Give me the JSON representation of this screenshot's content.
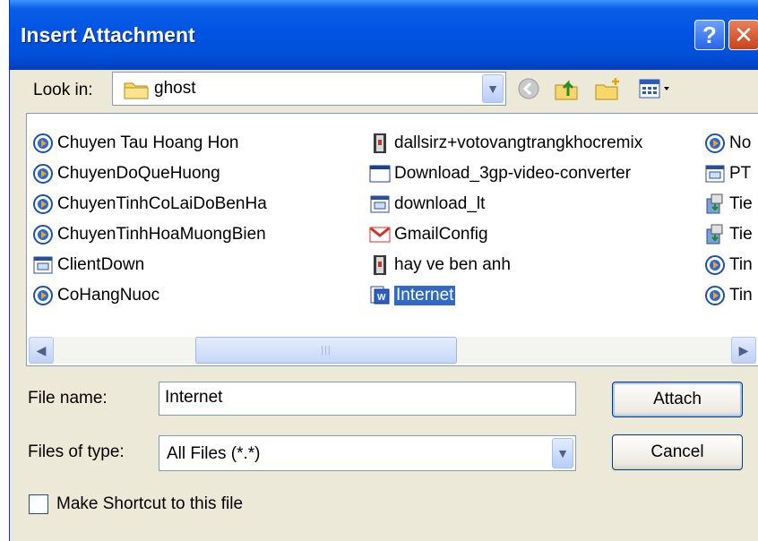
{
  "window": {
    "title": "Insert Attachment",
    "help_glyph": "?",
    "close_glyph": "✕"
  },
  "look_in": {
    "label": "Look in:",
    "value": "ghost"
  },
  "toolbar": {
    "icons": [
      "back-icon",
      "up-folder-icon",
      "new-folder-icon",
      "view-menu-icon"
    ]
  },
  "files": {
    "column1": [
      {
        "name": "Chuyen Tau Hoang Hon",
        "icon": "media-icon"
      },
      {
        "name": "ChuyenDoQueHuong",
        "icon": "media-icon"
      },
      {
        "name": "ChuyenTinhCoLaiDoBenHa",
        "icon": "media-icon"
      },
      {
        "name": "ChuyenTinhHoaMuongBien",
        "icon": "media-icon"
      },
      {
        "name": "ClientDown",
        "icon": "window-icon"
      },
      {
        "name": "CoHangNuoc",
        "icon": "media-icon"
      }
    ],
    "column2": [
      {
        "name": "dallsirz+votovangtrangkhocremix",
        "icon": "archive-icon"
      },
      {
        "name": "Download_3gp-video-converter",
        "icon": "app-window-icon"
      },
      {
        "name": "download_lt",
        "icon": "window-icon"
      },
      {
        "name": "GmailConfig",
        "icon": "gmail-icon"
      },
      {
        "name": "hay ve ben anh",
        "icon": "archive-icon"
      },
      {
        "name": "Internet",
        "icon": "word-doc-icon",
        "selected": true
      }
    ],
    "column3": [
      {
        "name": "No",
        "icon": "media-icon"
      },
      {
        "name": "PT",
        "icon": "window-icon"
      },
      {
        "name": "Tie",
        "icon": "installer-icon"
      },
      {
        "name": "Tie",
        "icon": "installer-icon"
      },
      {
        "name": "Tin",
        "icon": "media-icon"
      },
      {
        "name": "Tin",
        "icon": "media-icon"
      }
    ]
  },
  "file_name": {
    "label": "File name:",
    "value": "Internet"
  },
  "files_of_type": {
    "label": "Files of type:",
    "value": "All Files (*.*)"
  },
  "buttons": {
    "attach": "Attach",
    "cancel": "Cancel"
  },
  "shortcut": {
    "label": "Make Shortcut to this file",
    "checked": false
  },
  "colors": {
    "title_bar": "#0054e3",
    "selection": "#316ac5",
    "dialog_bg": "#ece9d8"
  }
}
